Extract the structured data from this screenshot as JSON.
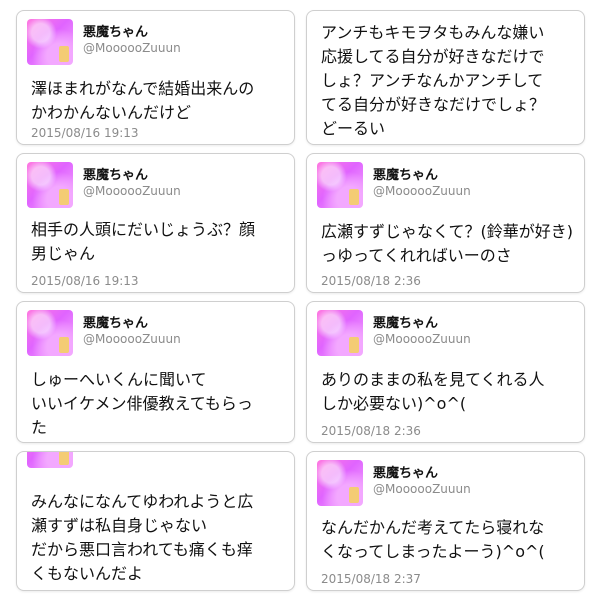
{
  "tweets": [
    {
      "name": "悪魔ちゃん",
      "handle": "@MoooooZuuun",
      "text": "澤ほまれがなんで結婚出来んの\nかわかんないんだけど",
      "time": "2015/08/16 19:13"
    },
    {
      "text": "アンチもキモヲタもみんな嫌い\n応援してる自分が好きなだけで\nしょ？アンチなんかアンチして\nてる自分が好きなだけでしょ？\nどーるい"
    },
    {
      "name": "悪魔ちゃん",
      "handle": "@MoooooZuuun",
      "text": "相手の人頭にだいじょうぶ？顔\n男じゃん",
      "time": "2015/08/16 19:13"
    },
    {
      "name": "悪魔ちゃん",
      "handle": "@MoooooZuuun",
      "text": "広瀬すずじゃなくて？(鈴華が好き)っゆってくれればいーのさ",
      "time": "2015/08/18 2:36"
    },
    {
      "name": "悪魔ちゃん",
      "handle": "@MoooooZuuun",
      "text": "しゅーへいくんに聞いて\nいいイケメン俳優教えてもらっ\nた"
    },
    {
      "name": "悪魔ちゃん",
      "handle": "@MoooooZuuun",
      "text": "ありのままの私を見てくれる人\nしか必要ない)^o^(",
      "time": "2015/08/18 2:36"
    },
    {
      "text": "みんなになんてゆわれようと広\n瀬すずは私自身じゃない\nだから悪口言われても痛くも痒\nくもないんだよ"
    },
    {
      "name": "悪魔ちゃん",
      "handle": "@MoooooZuuun",
      "text": "なんだかんだ考えてたら寝れな\nくなってしまったよーう)^o^(",
      "time": "2015/08/18 2:37"
    }
  ]
}
